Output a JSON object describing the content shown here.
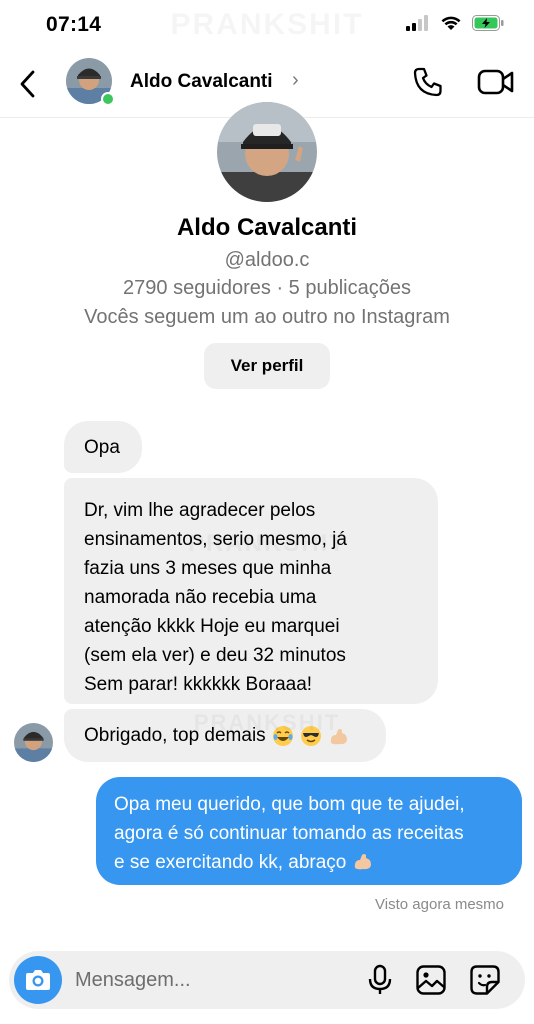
{
  "status_bar": {
    "time": "07:14",
    "watermark": "PRANKSHIT"
  },
  "header": {
    "name": "Aldo Cavalcanti",
    "chevron": "›"
  },
  "profile": {
    "name": "Aldo Cavalcanti",
    "handle": "@aldoo.c",
    "stats": "2790 seguidores · 5 publicações",
    "mutual": "Vocês seguem um ao outro no Instagram",
    "view_profile_label": "Ver perfil"
  },
  "messages": [
    {
      "from": "them",
      "text": "Opa"
    },
    {
      "from": "them",
      "lines": [
        "Dr, vim lhe agradecer pelos",
        "ensinamentos, serio mesmo, já",
        "fazia uns 3 meses que minha",
        "namorada não recebia uma",
        "atenção kkkk Hoje eu marquei",
        "(sem ela ver) e deu 32 minutos",
        "Sem parar! kkkkkk Boraaa!"
      ]
    },
    {
      "from": "them",
      "text": "Obrigado, top demais",
      "emojis": [
        "laughing-emoji",
        "sunglasses-emoji",
        "flexed-biceps-emoji"
      ]
    },
    {
      "from": "me",
      "lines": [
        "Opa meu querido, que bom que te ajudei,",
        "agora é só continuar tomando as receitas",
        "e se exercitando kk, abraço"
      ],
      "emojis": [
        "flexed-biceps-emoji"
      ]
    }
  ],
  "seen_status": "Visto agora mesmo",
  "composer": {
    "placeholder": "Mensagem..."
  },
  "colors": {
    "accent": "#3797f0",
    "incoming_bubble": "#efefef",
    "online": "#3fc55d",
    "battery": "#34c759"
  }
}
